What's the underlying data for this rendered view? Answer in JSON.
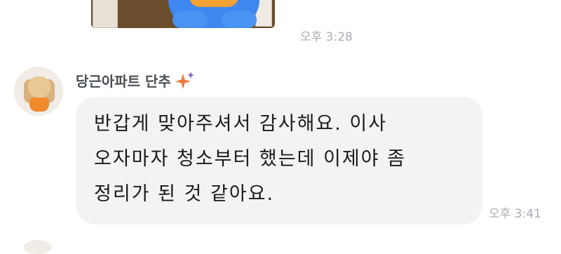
{
  "messages": {
    "sticker_time": "오후 3:28",
    "sender_name": "당근아파트 단추",
    "text_lines": [
      "반갑게 맞아주셔서 감사해요. 이사",
      "오자마자 청소부터 했는데 이제야 좀",
      "정리가 된 것 같아요."
    ],
    "text_time": "오후 3:41"
  },
  "icons": {
    "avatar": "dog-avatar-icon",
    "badge": "sparkle-icon"
  },
  "colors": {
    "bubble_bg": "#f2f3f5",
    "time": "#a8adb3",
    "sparkle_main": "#ef7a3c",
    "sparkle_small": "#8e5cc9"
  }
}
